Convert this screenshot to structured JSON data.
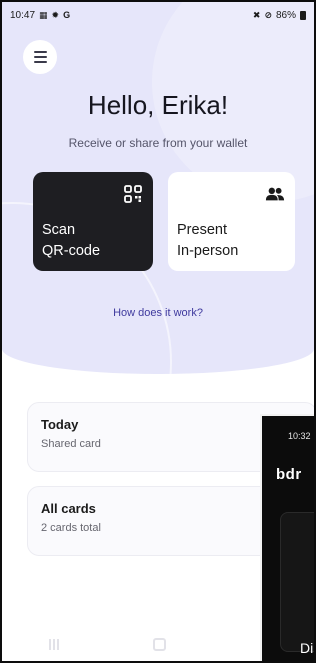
{
  "status_bar": {
    "time": "10:47",
    "left_icons": [
      "message-icon",
      "gear-icon",
      "google-icon"
    ],
    "right_icons": [
      "mute-icon",
      "do-not-disturb-icon"
    ],
    "battery": "86%"
  },
  "header": {
    "menu_icon": "hamburger-menu-icon",
    "greeting": "Hello, Erika!",
    "subtitle": "Receive or share from your wallet"
  },
  "actions": {
    "scan": {
      "line1": "Scan",
      "line2": "QR-code",
      "icon": "qr-scan-icon"
    },
    "present": {
      "line1": "Present",
      "line2": "In-person",
      "icon": "people-icon"
    }
  },
  "how_link": "How does it work?",
  "cards": {
    "today": {
      "title": "Today",
      "subtitle": "Shared card"
    },
    "all": {
      "title": "All cards",
      "subtitle": "2 cards total"
    }
  },
  "overlay": {
    "time": "10:32",
    "logo": "bdr",
    "bottom_text": "Di"
  },
  "colors": {
    "hero_bg": "#e6e6fa",
    "scan_card_bg": "#1e1e22",
    "link": "#3f3a9e"
  }
}
